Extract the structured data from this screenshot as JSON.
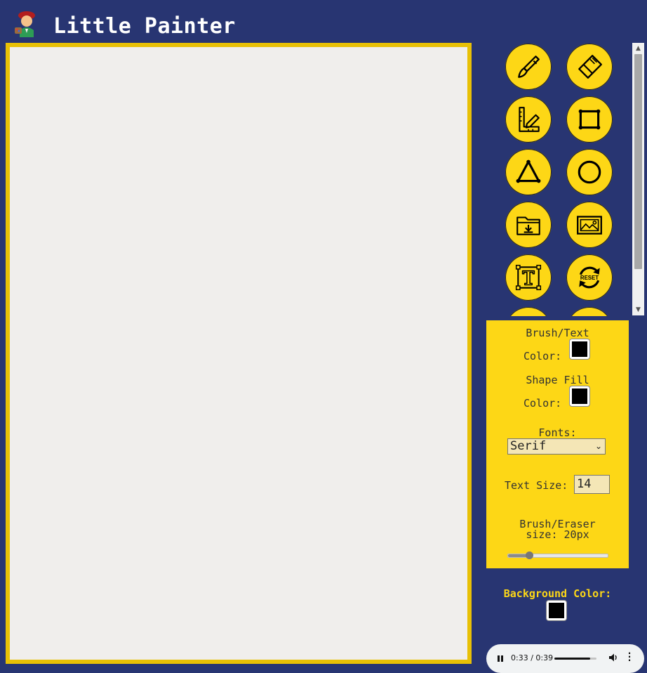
{
  "app": {
    "title": "Little Painter",
    "logo_icon": "painter-emoji-icon"
  },
  "canvas": {
    "background": "#f0eeec",
    "border_color": "#e8c006"
  },
  "tools": [
    {
      "name": "brush",
      "icon": "brush-icon"
    },
    {
      "name": "eraser",
      "icon": "eraser-icon"
    },
    {
      "name": "line",
      "icon": "ruler-pencil-icon"
    },
    {
      "name": "rectangle",
      "icon": "rectangle-icon"
    },
    {
      "name": "triangle",
      "icon": "triangle-icon"
    },
    {
      "name": "circle",
      "icon": "circle-icon"
    },
    {
      "name": "save",
      "icon": "download-folder-icon"
    },
    {
      "name": "image",
      "icon": "image-icon"
    },
    {
      "name": "text",
      "icon": "text-box-icon"
    },
    {
      "name": "reset",
      "icon": "reset-icon",
      "label": "RESET"
    }
  ],
  "panel": {
    "brush_text_label_1": "Brush/Text",
    "brush_text_label_2": "Color:",
    "shape_fill_label_1": "Shape Fill",
    "shape_fill_label_2": "Color:",
    "fonts_label": "Fonts:",
    "font_selected": "Serif",
    "text_size_label": "Text Size:",
    "text_size_value": "14",
    "brush_size_label_1": "Brush/Eraser",
    "brush_size_label_2": "size: 20px",
    "brush_size_fraction": 0.21,
    "brush_color": "#000000",
    "shape_fill_color": "#000000"
  },
  "background": {
    "label": "Background Color:",
    "color": "#000000"
  },
  "audio": {
    "time": "0:33 / 0:39",
    "progress_fraction": 0.846
  },
  "colors": {
    "page_bg": "#283572",
    "accent_yellow": "#fdd716"
  }
}
